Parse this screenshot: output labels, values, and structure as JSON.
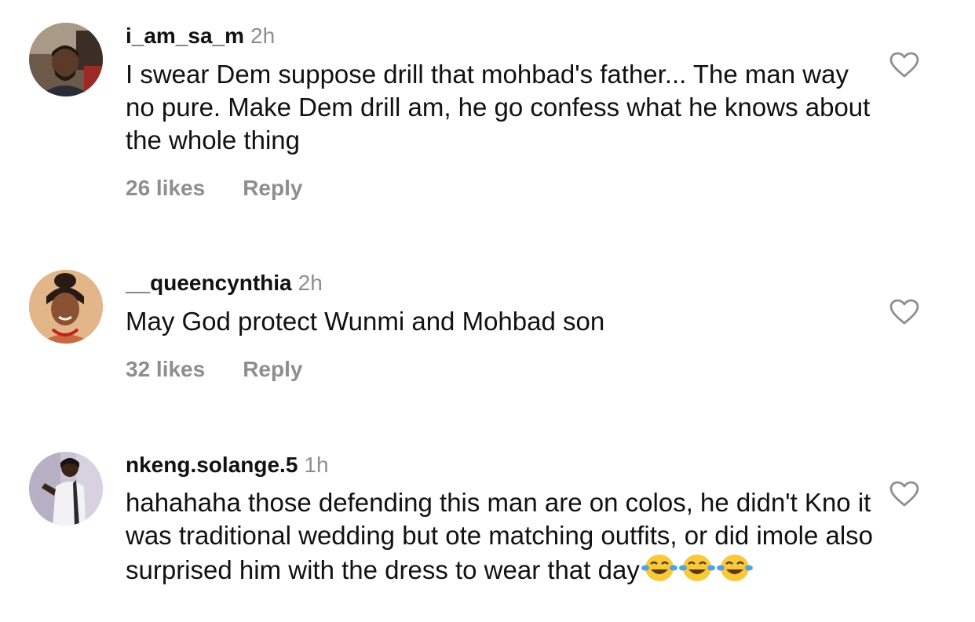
{
  "comments": [
    {
      "username": "i_am_sa_m",
      "time": "2h",
      "text": "I swear Dem suppose drill that mohbad's father... The man way no pure.  Make Dem drill am, he go confess what he knows about the whole thing",
      "likes": "26 likes",
      "reply": "Reply",
      "avatar_icon": "man-in-car-avatar"
    },
    {
      "username": "__queencynthia",
      "time": "2h",
      "text": "May God protect Wunmi and Mohbad son",
      "likes": "32 likes",
      "reply": "Reply",
      "avatar_icon": "woman-smiling-avatar"
    },
    {
      "username": "nkeng.solange.5",
      "time": "1h",
      "text": "hahahaha those defending this man are on colos, he didn't Kno it was traditional wedding but ote matching outfits, or did imole also surprised him with the dress to wear that day",
      "emoji": "😂😂😂",
      "avatar_icon": "woman-posing-avatar"
    }
  ],
  "icons": {
    "like": "heart-outline-icon",
    "emoji": "face-with-tears-of-joy-icon"
  },
  "colors": {
    "text": "#111111",
    "secondary": "#8e8e8e",
    "background": "#ffffff"
  }
}
